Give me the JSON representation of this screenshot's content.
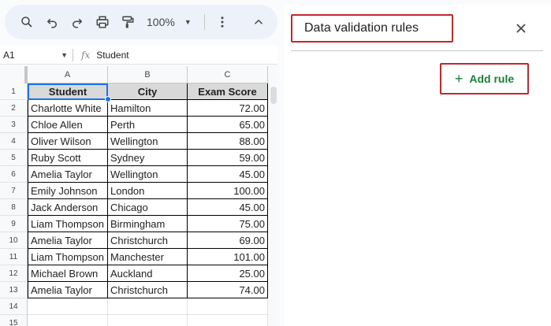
{
  "toolbar": {
    "zoom": "100%",
    "icons": [
      "search-icon",
      "undo-icon",
      "redo-icon",
      "print-icon",
      "paint-format-icon",
      "more-vert-icon",
      "chevron-up-icon"
    ]
  },
  "formula_bar": {
    "cell_ref": "A1",
    "fx_label": "fx",
    "value": "Student"
  },
  "grid": {
    "columns": [
      "A",
      "B",
      "C"
    ],
    "row_numbers": [
      "1",
      "2",
      "3",
      "4",
      "5",
      "6",
      "7",
      "8",
      "9",
      "10",
      "11",
      "12",
      "13",
      "14",
      "15"
    ],
    "headers": [
      "Student",
      "City",
      "Exam Score"
    ],
    "rows": [
      [
        "Charlotte White",
        "Hamilton",
        "72.00"
      ],
      [
        "Chloe Allen",
        "Perth",
        "65.00"
      ],
      [
        "Oliver Wilson",
        "Wellington",
        "88.00"
      ],
      [
        "Ruby Scott",
        "Sydney",
        "59.00"
      ],
      [
        "Amelia Taylor",
        "Wellington",
        "45.00"
      ],
      [
        "Emily Johnson",
        "London",
        "100.00"
      ],
      [
        "Jack Anderson",
        "Chicago",
        "45.00"
      ],
      [
        "Liam Thompson",
        "Birmingham",
        "75.00"
      ],
      [
        "Amelia Taylor",
        "Christchurch",
        "69.00"
      ],
      [
        "Liam Thompson",
        "Manchester",
        "101.00"
      ],
      [
        "Michael Brown",
        "Auckland",
        "25.00"
      ],
      [
        "Amelia Taylor",
        "Christchurch",
        "74.00"
      ]
    ]
  },
  "panel": {
    "title": "Data validation rules",
    "add_rule_label": "Add rule",
    "add_rule_icon": "+"
  },
  "colors": {
    "highlight_border": "#c0282d",
    "add_rule_green": "#188038",
    "selection_blue": "#1a73e8",
    "header_fill": "#d9d9d9"
  }
}
